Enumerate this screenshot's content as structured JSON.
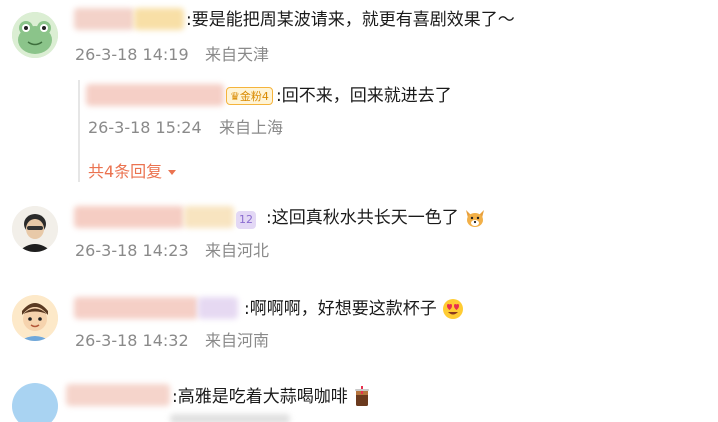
{
  "comments": [
    {
      "text": ":要是能把周某波请来，就更有喜剧效果了～",
      "date": "26-3-18 14:19",
      "location": "来自天津",
      "reply": {
        "badge": "金粉4",
        "text": ":回不来，回来就进去了",
        "date": "26-3-18 15:24",
        "location": "来自上海"
      },
      "reply_count": "共4条回复"
    },
    {
      "badge": "12",
      "text": ":这回真秋水共长天一色了",
      "date": "26-3-18 14:23",
      "location": "来自河北"
    },
    {
      "text": ":啊啊啊，好想要这款杯子",
      "date": "26-3-18 14:32",
      "location": "来自河南"
    },
    {
      "text": ":高雅是吃着大蒜喝咖啡",
      "date": "",
      "location": ""
    }
  ],
  "colors": {
    "accent": "#eb7350",
    "meta": "#8a8a8a",
    "badge_gold": "#f5b43c",
    "badge_purple": "#a78bd8"
  },
  "icons": [
    "frog-avatar-icon",
    "dog-face-emoji-icon",
    "heart-eyes-emoji-icon",
    "iced-coffee-emoji-icon",
    "chevron-down-icon"
  ]
}
